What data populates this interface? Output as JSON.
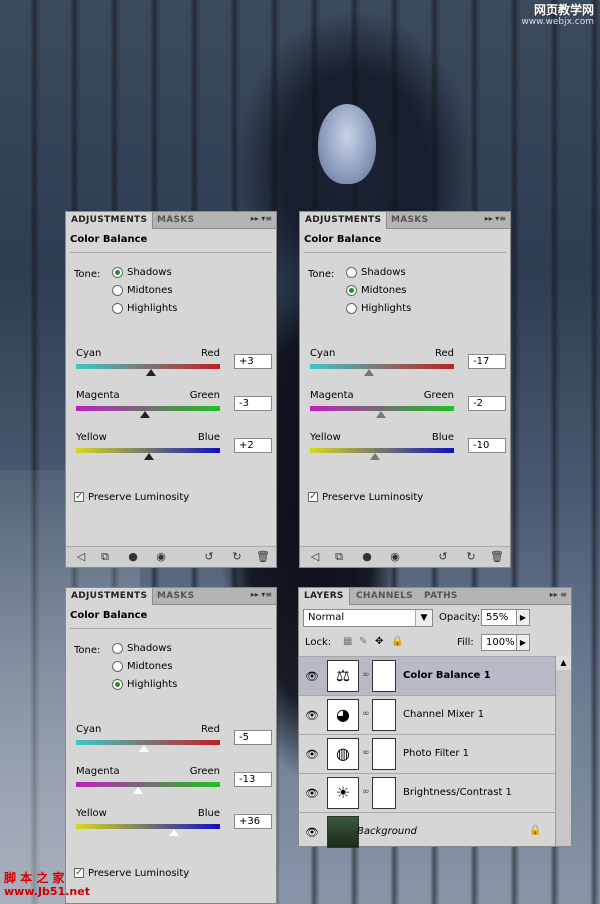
{
  "watermark_top": {
    "line1": "网页教学网",
    "line2": "www.webjx.com"
  },
  "watermark_bottom": {
    "line1": "脚 本 之 家",
    "line2": "www.Jb51.net"
  },
  "panels": [
    {
      "tabs": [
        "ADJUSTMENTS",
        "MASKS"
      ],
      "title": "Color Balance",
      "tone_label": "Tone:",
      "tones": [
        "Shadows",
        "Midtones",
        "Highlights"
      ],
      "selected_tone": "Shadows",
      "sliders": [
        {
          "left": "Cyan",
          "right": "Red",
          "value": "+3",
          "pos": 0.52
        },
        {
          "left": "Magenta",
          "right": "Green",
          "value": "-3",
          "pos": 0.48
        },
        {
          "left": "Yellow",
          "right": "Blue",
          "value": "+2",
          "pos": 0.51
        }
      ],
      "preserve": "Preserve Luminosity"
    },
    {
      "tabs": [
        "ADJUSTMENTS",
        "MASKS"
      ],
      "title": "Color Balance",
      "tone_label": "Tone:",
      "tones": [
        "Shadows",
        "Midtones",
        "Highlights"
      ],
      "selected_tone": "Midtones",
      "sliders": [
        {
          "left": "Cyan",
          "right": "Red",
          "value": "-17",
          "pos": 0.41
        },
        {
          "left": "Magenta",
          "right": "Green",
          "value": "-2",
          "pos": 0.49
        },
        {
          "left": "Yellow",
          "right": "Blue",
          "value": "-10",
          "pos": 0.45
        }
      ],
      "preserve": "Preserve Luminosity"
    },
    {
      "tabs": [
        "ADJUSTMENTS",
        "MASKS"
      ],
      "title": "Color Balance",
      "tone_label": "Tone:",
      "tones": [
        "Shadows",
        "Midtones",
        "Highlights"
      ],
      "selected_tone": "Highlights",
      "sliders": [
        {
          "left": "Cyan",
          "right": "Red",
          "value": "-5",
          "pos": 0.47
        },
        {
          "left": "Magenta",
          "right": "Green",
          "value": "-13",
          "pos": 0.43
        },
        {
          "left": "Yellow",
          "right": "Blue",
          "value": "+36",
          "pos": 0.68
        }
      ],
      "preserve": "Preserve Luminosity"
    }
  ],
  "layers": {
    "tabs": [
      "LAYERS",
      "CHANNELS",
      "PATHS"
    ],
    "blend_mode": "Normal",
    "opacity_label": "Opacity:",
    "opacity": "55%",
    "lock_label": "Lock:",
    "fill_label": "Fill:",
    "fill": "100%",
    "items": [
      {
        "name": "Color Balance 1",
        "icon": "scale-icon",
        "glyph": "⚖",
        "selected": true,
        "mask": true
      },
      {
        "name": "Channel Mixer 1",
        "icon": "channel-mixer-icon",
        "glyph": "◕",
        "selected": false,
        "mask": true
      },
      {
        "name": "Photo Filter 1",
        "icon": "photo-filter-icon",
        "glyph": "◍",
        "selected": false,
        "mask": true
      },
      {
        "name": "Brightness/Contrast 1",
        "icon": "brightness-icon",
        "glyph": "☀",
        "selected": false,
        "mask": true
      },
      {
        "name": "Background",
        "icon": "background-thumbnail",
        "glyph": "",
        "selected": false,
        "mask": false,
        "italic": true,
        "locked": true
      }
    ]
  }
}
